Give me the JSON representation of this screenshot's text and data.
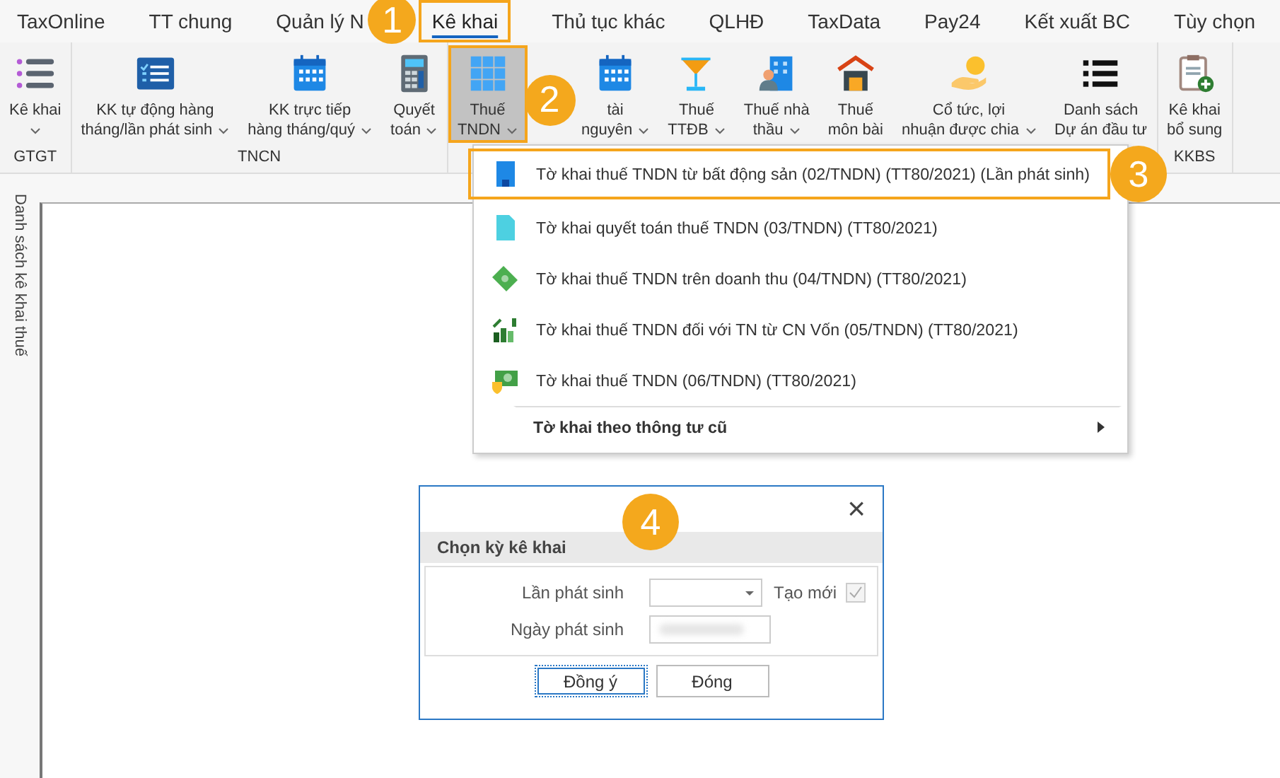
{
  "tabs": [
    {
      "label": "TaxOnline",
      "selected": false
    },
    {
      "label": "TT chung",
      "selected": false
    },
    {
      "label": "Quản lý N",
      "selected": false
    },
    {
      "label": "Kê khai",
      "selected": true
    },
    {
      "label": "Thủ tục khác",
      "selected": false
    },
    {
      "label": "QLHĐ",
      "selected": false
    },
    {
      "label": "TaxData",
      "selected": false
    },
    {
      "label": "Pay24",
      "selected": false
    },
    {
      "label": "Kết xuất BC",
      "selected": false
    },
    {
      "label": "Tùy chọn",
      "selected": false
    }
  ],
  "ribbon": {
    "groups": [
      {
        "label": "GTGT",
        "buttons": [
          {
            "lines": [
              "Kê khai"
            ],
            "dropdown": true,
            "selected": false
          }
        ]
      },
      {
        "label": "TNCN",
        "buttons": [
          {
            "lines": [
              "KK tự động hàng",
              "tháng/lần phát sinh"
            ],
            "dropdown": true,
            "selected": false
          },
          {
            "lines": [
              "KK trực tiếp",
              "hàng tháng/quý"
            ],
            "dropdown": true,
            "selected": false
          },
          {
            "lines": [
              "Quyết",
              "toán"
            ],
            "dropdown": true,
            "selected": false
          }
        ]
      },
      {
        "buttons": [
          {
            "lines": [
              "Thuế",
              "TNDN"
            ],
            "dropdown": true,
            "selected": true
          },
          {
            "lines": [
              "tài",
              "nguyên"
            ],
            "dropdown": true,
            "selected": false
          },
          {
            "lines": [
              "Thuế",
              "TTĐB"
            ],
            "dropdown": true,
            "selected": false
          },
          {
            "lines": [
              "Thuế nhà",
              "thầu"
            ],
            "dropdown": true,
            "selected": false
          },
          {
            "lines": [
              "Thuế",
              "môn bài"
            ],
            "dropdown": false,
            "selected": false
          },
          {
            "lines": [
              "Cổ tức, lợi",
              "nhuận được chia"
            ],
            "dropdown": true,
            "selected": false
          },
          {
            "lines": [
              "Danh sách",
              "Dự án đầu tư"
            ],
            "dropdown": false,
            "selected": false
          }
        ]
      },
      {
        "label": "KKBS",
        "buttons": [
          {
            "lines": [
              "Kê khai",
              "bổ sung"
            ],
            "dropdown": false,
            "selected": false
          }
        ]
      }
    ]
  },
  "side_panel": {
    "title": "Danh sách kê khai thuế"
  },
  "menu": {
    "items": [
      {
        "kind": "item",
        "label": "Tờ khai thuế TNDN từ bất động sản (02/TNDN) (TT80/2021) (Lần phát sinh)",
        "selected": true
      },
      {
        "kind": "item",
        "label": "Tờ khai quyết toán thuế TNDN (03/TNDN) (TT80/2021)",
        "selected": false
      },
      {
        "kind": "item",
        "label": "Tờ khai thuế TNDN trên doanh thu (04/TNDN) (TT80/2021)",
        "selected": false
      },
      {
        "kind": "item",
        "label": "Tờ khai thuế TNDN đối với TN từ CN Vốn (05/TNDN) (TT80/2021)",
        "selected": false
      },
      {
        "kind": "item",
        "label": "Tờ khai thuế TNDN (06/TNDN) (TT80/2021)",
        "selected": false
      },
      {
        "kind": "submenu",
        "label": "Tờ khai theo thông tư cũ",
        "selected": false
      }
    ]
  },
  "dialog": {
    "close": "×",
    "title": "Chọn kỳ kê khai",
    "fields": [
      {
        "kind": "combo",
        "label": "Lần phát sinh"
      },
      {
        "kind": "date",
        "label": "Ngày phát sinh"
      }
    ],
    "new_option": {
      "label": "Tạo mới",
      "checked": true,
      "disabled": true
    },
    "buttons": [
      {
        "label": "Đồng ý",
        "focused": true
      },
      {
        "label": "Đóng",
        "focused": false
      }
    ]
  },
  "callouts": [
    {
      "number": "1"
    },
    {
      "number": "2"
    },
    {
      "number": "3"
    },
    {
      "number": "4"
    }
  ]
}
